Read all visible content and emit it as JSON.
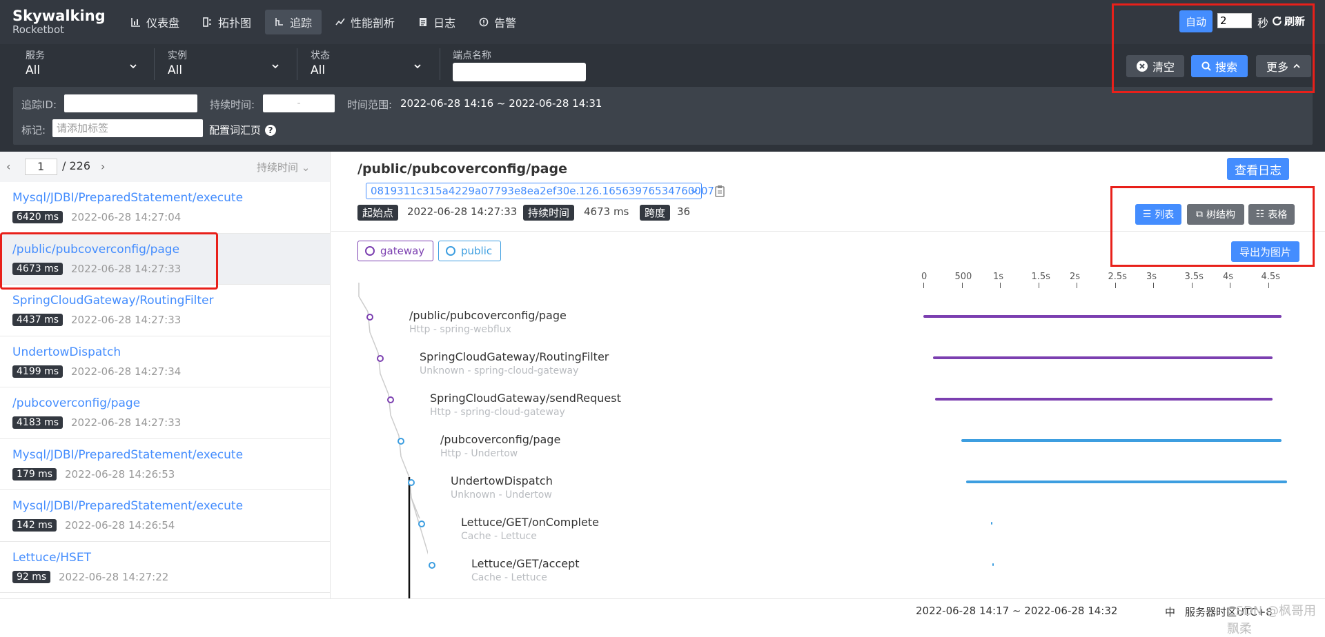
{
  "header": {
    "logo_title": "Skywalking",
    "logo_sub": "Rocketbot",
    "nav": [
      {
        "label": "仪表盘",
        "icon": "chart-icon"
      },
      {
        "label": "拓扑图",
        "icon": "topology-icon"
      },
      {
        "label": "追踪",
        "icon": "trace-icon"
      },
      {
        "label": "性能剖析",
        "icon": "profile-icon"
      },
      {
        "label": "日志",
        "icon": "log-icon"
      },
      {
        "label": "告警",
        "icon": "alarm-icon"
      }
    ],
    "auto_label": "自动",
    "interval_value": "2",
    "seconds_label": "秒",
    "refresh_label": "刷新"
  },
  "filters": {
    "service": {
      "label": "服务",
      "value": "All"
    },
    "instance": {
      "label": "实例",
      "value": "All"
    },
    "status": {
      "label": "状态",
      "value": "All"
    },
    "endpoint": {
      "label": "端点名称",
      "value": ""
    },
    "clear_label": "清空",
    "search_label": "搜索",
    "more_label": "更多"
  },
  "advanced": {
    "trace_id_label": "追踪ID:",
    "duration_label": "持续时间:",
    "duration_placeholder": "-",
    "time_range_label": "时间范围:",
    "time_range_value": "2022-06-28 14:16 ~ 2022-06-28 14:31",
    "tags_label": "标记:",
    "tags_placeholder": "请添加标签",
    "config_vocab_label": "配置词汇页"
  },
  "trace_list": {
    "page": "1",
    "total": "/ 226",
    "sort_label": "持续时间",
    "items": [
      {
        "endpoint": "Mysql/JDBI/PreparedStatement/execute",
        "duration": "6420 ms",
        "time": "2022-06-28 14:27:04"
      },
      {
        "endpoint": "/public/pubcoverconfig/page",
        "duration": "4673 ms",
        "time": "2022-06-28 14:27:33"
      },
      {
        "endpoint": "SpringCloudGateway/RoutingFilter",
        "duration": "4437 ms",
        "time": "2022-06-28 14:27:33"
      },
      {
        "endpoint": "UndertowDispatch",
        "duration": "4199 ms",
        "time": "2022-06-28 14:27:34"
      },
      {
        "endpoint": "/pubcoverconfig/page",
        "duration": "4183 ms",
        "time": "2022-06-28 14:27:33"
      },
      {
        "endpoint": "Mysql/JDBI/PreparedStatement/execute",
        "duration": "179 ms",
        "time": "2022-06-28 14:26:53"
      },
      {
        "endpoint": "Mysql/JDBI/PreparedStatement/execute",
        "duration": "142 ms",
        "time": "2022-06-28 14:26:54"
      },
      {
        "endpoint": "Lettuce/HSET",
        "duration": "92 ms",
        "time": "2022-06-28 14:27:22"
      }
    ]
  },
  "detail": {
    "title": "/public/pubcoverconfig/page",
    "trace_id": "0819311c315a4229a07793e8ea2ef30e.126.16563976534760007",
    "start_label": "起始点",
    "start_value": "2022-06-28 14:27:33",
    "duration_label": "持续时间",
    "duration_value": "4673 ms",
    "span_label": "跨度",
    "span_value": "36",
    "view_log_label": "查看日志",
    "list_label": "列表",
    "tree_label": "树结构",
    "table_label": "表格",
    "export_label": "导出为图片",
    "legend": [
      {
        "name": "gateway",
        "color": "#7b3fb0"
      },
      {
        "name": "public",
        "color": "#3d9ee0"
      }
    ],
    "axis_ticks": [
      "0",
      "500",
      "1s",
      "1.5s",
      "2s",
      "2.5s",
      "3s",
      "3.5s",
      "4s",
      "4.5s"
    ],
    "spans": [
      {
        "name": "/public/pubcoverconfig/page",
        "sub": "Http - spring-webflux",
        "color": "#7b3fb0",
        "start": 0,
        "end": 4673
      },
      {
        "name": "SpringCloudGateway/RoutingFilter",
        "sub": "Unknown - spring-cloud-gateway",
        "color": "#7b3fb0",
        "start": 130,
        "end": 4560
      },
      {
        "name": "SpringCloudGateway/sendRequest",
        "sub": "Http - spring-cloud-gateway",
        "color": "#7b3fb0",
        "start": 155,
        "end": 4560
      },
      {
        "name": "/pubcoverconfig/page",
        "sub": "Http - Undertow",
        "color": "#3d9ee0",
        "start": 495,
        "end": 4673
      },
      {
        "name": "UndertowDispatch",
        "sub": "Unknown - Undertow",
        "color": "#3d9ee0",
        "start": 560,
        "end": 4750
      },
      {
        "name": "Lettuce/GET/onComplete",
        "sub": "Cache - Lettuce",
        "color": "#3d9ee0",
        "start": 880,
        "end": 886
      },
      {
        "name": "Lettuce/GET/accept",
        "sub": "Cache - Lettuce",
        "color": "#3d9ee0",
        "start": 900,
        "end": 906
      }
    ]
  },
  "footer": {
    "time_range": "2022-06-28 14:17 ~ 2022-06-28 14:32",
    "lang": "中",
    "server_tz": "服务器时区UTC+8",
    "watermark": "CSDN @枫哥用飘柔"
  }
}
